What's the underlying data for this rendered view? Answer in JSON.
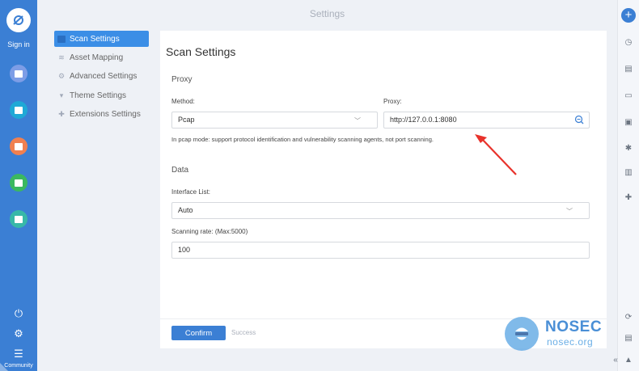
{
  "window": {
    "title": "Settings"
  },
  "leftbar": {
    "signin_label": "Sign in",
    "community_label": "Community",
    "nav_colors": [
      "#7d9de6",
      "#1fa9d6",
      "#f08050",
      "#3bb860",
      "#37b8a8"
    ]
  },
  "menu": {
    "items": [
      {
        "label": "Scan Settings",
        "icon": "scan-icon"
      },
      {
        "label": "Asset Mapping",
        "icon": "layers-icon"
      },
      {
        "label": "Advanced Settings",
        "icon": "gear-icon"
      },
      {
        "label": "Theme Settings",
        "icon": "shirt-icon"
      },
      {
        "label": "Extensions Settings",
        "icon": "puzzle-icon"
      }
    ],
    "active_index": 0
  },
  "panel": {
    "title": "Scan Settings",
    "proxy_section": "Proxy",
    "method_label": "Method:",
    "method_value": "Pcap",
    "proxy_label": "Proxy:",
    "proxy_value": "http://127.0.0.1:8080",
    "hint": "In pcap mode: support protocol identification and vulnerability scanning agents, not port scanning.",
    "data_section": "Data",
    "interface_label": "Interface List:",
    "interface_value": "Auto",
    "rate_label": "Scanning rate: (Max:5000)",
    "rate_value": "100",
    "confirm_label": "Confirm",
    "status_text": "Success"
  },
  "watermark": {
    "brand": "NOSEC",
    "domain": "nosec.org"
  },
  "colors": {
    "accent": "#3b7fd4",
    "sidebar": "#3b7fd4",
    "annotation": "#e8322b"
  }
}
